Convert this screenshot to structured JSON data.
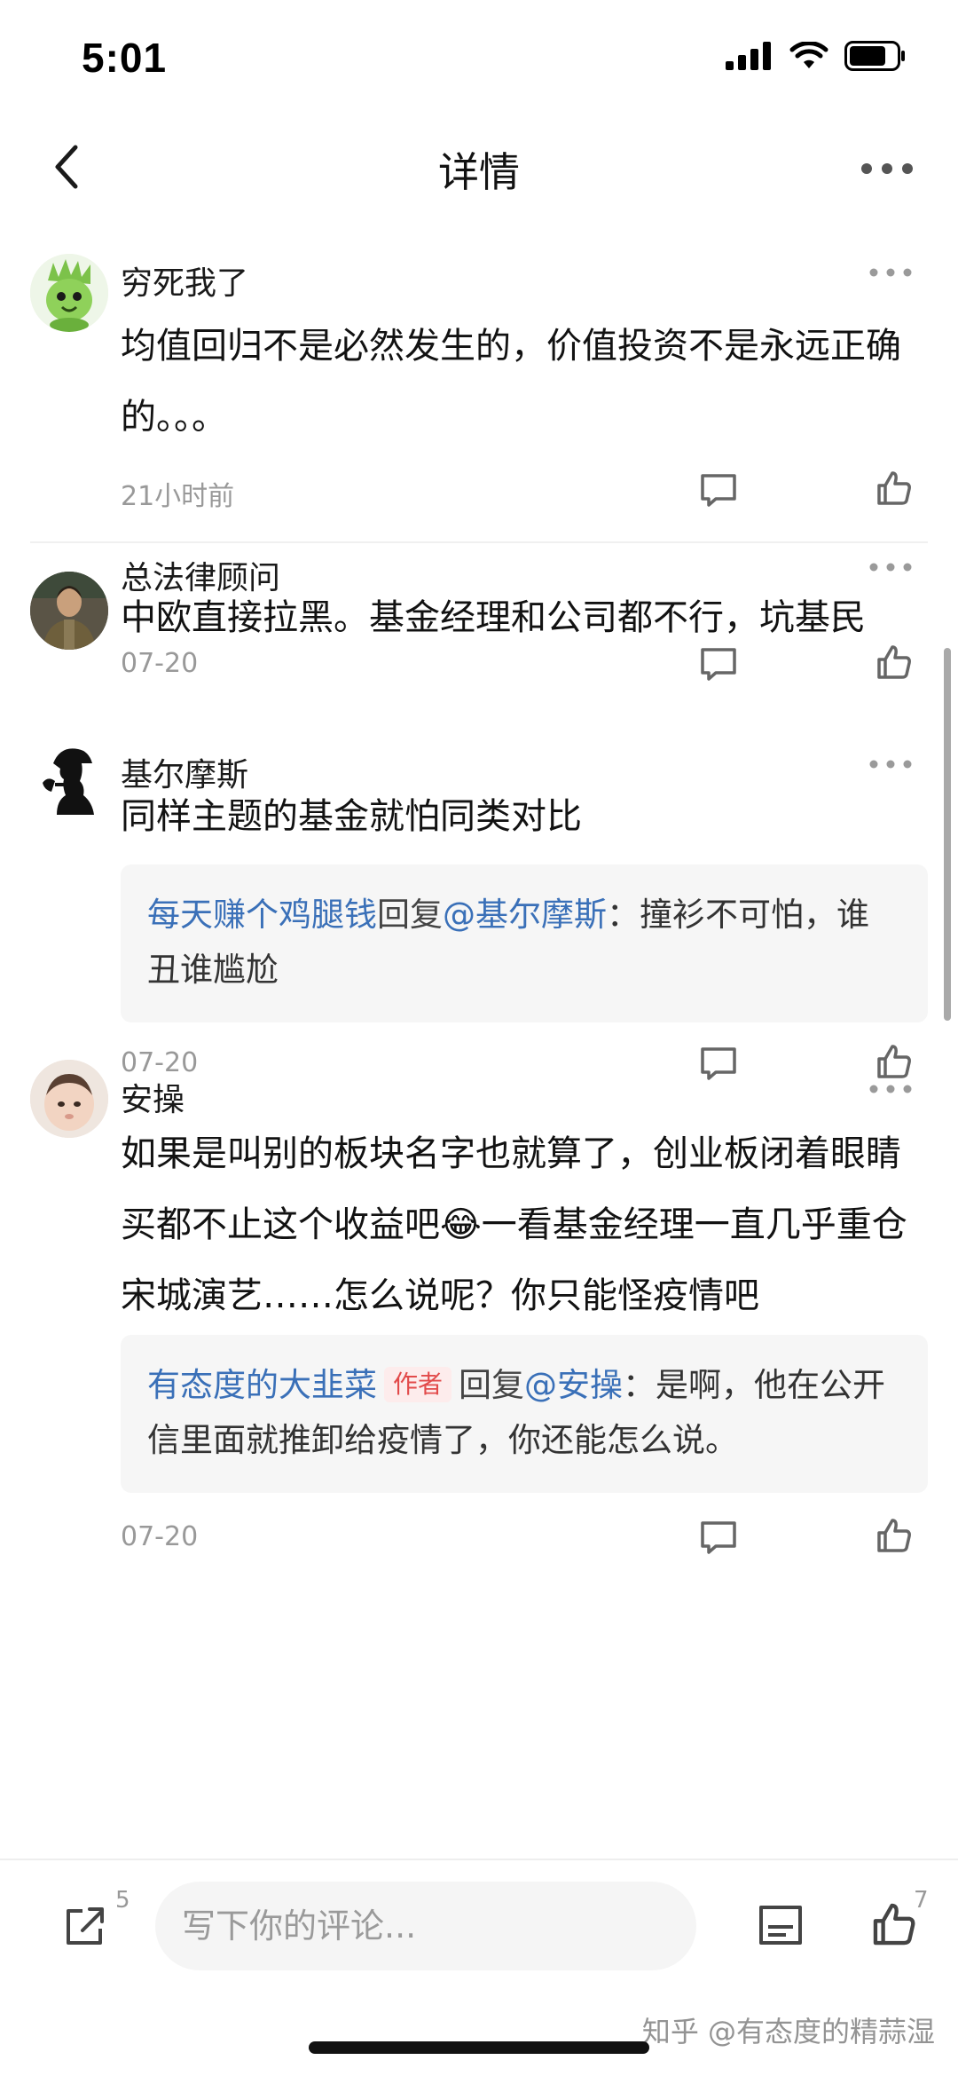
{
  "status": {
    "time": "5:01"
  },
  "header": {
    "title": "详情"
  },
  "comments": [
    {
      "author": "穷死我了",
      "content": "均值回归不是必然发生的，价值投资不是永远正确的。。。",
      "time": "21小时前"
    },
    {
      "author": "总法律顾问",
      "content": "中欧直接拉黑。基金经理和公司都不行，坑基民",
      "time": "07-20"
    },
    {
      "author": "基尔摩斯",
      "content": "同样主题的基金就怕同类对比",
      "reply": {
        "from": "每天赚个鸡腿钱",
        "verb": "回复",
        "to": "@基尔摩斯",
        "text": "：撞衫不可怕，谁丑谁尴尬"
      },
      "time": "07-20"
    },
    {
      "author": "安操",
      "content": "如果是叫别的板块名字也就算了，创业板闭着眼睛买都不止这个收益吧😂一看基金经理一直几乎重仓宋城演艺……怎么说呢？你只能怪疫情吧",
      "reply": {
        "from": "有态度的大韭菜",
        "tag": "作者",
        "verb": "回复",
        "to": "@安操",
        "text": "：是啊，他在公开信里面就推卸给疫情了，你还能怎么说。"
      },
      "time": "07-20"
    }
  ],
  "bottom": {
    "share_count": "5",
    "comment_placeholder": "写下你的评论...",
    "like_count": "7"
  },
  "watermark": "知乎 @有态度的精蒜湿",
  "colors": {
    "link": "#3a70b8",
    "author_tag_bg": "#fdecec",
    "author_tag_text": "#e24a4a",
    "meta": "#999999"
  }
}
